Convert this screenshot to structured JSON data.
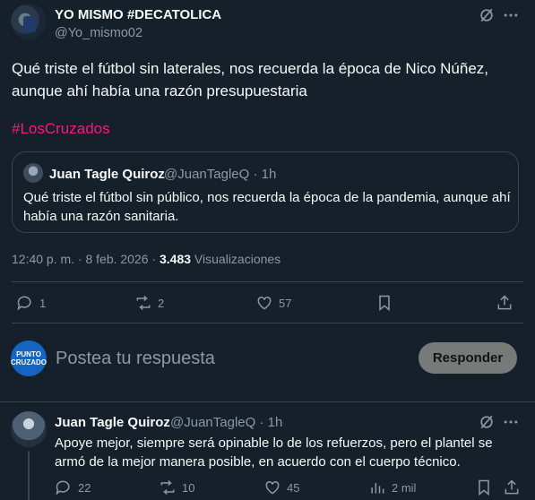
{
  "post": {
    "author_name": "YO MISMO #DECATOLICA",
    "author_handle": "@Yo_mismo02",
    "text": "Qué triste el fútbol sin laterales, nos recuerda la época de Nico Núñez, aunque ahí había una razón presupuestaria",
    "hashtag": "#LosCruzados",
    "quote": {
      "name": "Juan Tagle Quiroz",
      "handle_time": "@JuanTagleQ · 1h",
      "text": "Qué triste el fútbol sin público, nos recuerda la época de la pandemia, aunque ahí había una razón sanitaria."
    },
    "time": "12:40 p. m. · 8 feb. 2026 · ",
    "views_count": "3.483",
    "views_label": " Visualizaciones",
    "actions": {
      "replies": "1",
      "reposts": "2",
      "likes": "57"
    }
  },
  "reply_box": {
    "avatar_text_1": "PUNTO",
    "avatar_text_2": "CRUZADO",
    "placeholder": "Postea tu respuesta",
    "button": "Responder"
  },
  "reply": {
    "name": "Juan Tagle Quiroz",
    "handle_time": "@JuanTagleQ · 1h",
    "text": "Apoye mejor, siempre será opinable lo de los refuerzos, pero el plantel se armó de la mejor manera posible, en acuerdo con el cuerpo técnico.",
    "actions": {
      "replies": "22",
      "reposts": "10",
      "likes": "45",
      "views": "2 mil"
    }
  },
  "colors": {
    "background": "#15202b",
    "hashtag": "#f91880",
    "muted": "#8b98a5",
    "border": "#38444d"
  }
}
